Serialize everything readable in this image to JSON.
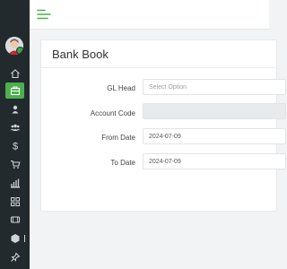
{
  "page": {
    "title": "Bank Book"
  },
  "sidebar": {
    "items": [
      {
        "icon": "home-icon",
        "active": false
      },
      {
        "icon": "briefcase-icon",
        "active": true
      },
      {
        "icon": "user-icon",
        "active": false
      },
      {
        "icon": "users-icon",
        "active": false
      },
      {
        "icon": "dollar-icon",
        "active": false
      },
      {
        "icon": "cart-icon",
        "active": false
      },
      {
        "icon": "bar-chart-icon",
        "active": false
      },
      {
        "icon": "grid-icon",
        "active": false
      },
      {
        "icon": "panel-icon",
        "active": false
      },
      {
        "icon": "cube-icon",
        "active": false
      },
      {
        "icon": "pin-icon",
        "active": false
      }
    ]
  },
  "form": {
    "gl_head": {
      "label": "GL Head",
      "placeholder": "Select Option"
    },
    "account_code": {
      "label": "Account Code",
      "value": ""
    },
    "from_date": {
      "label": "From Date",
      "value": "2024-07-09"
    },
    "to_date": {
      "label": "To Date",
      "value": "2024-07-09"
    }
  },
  "colors": {
    "accent": "#4caf50",
    "sidebar": "#232a2e"
  }
}
